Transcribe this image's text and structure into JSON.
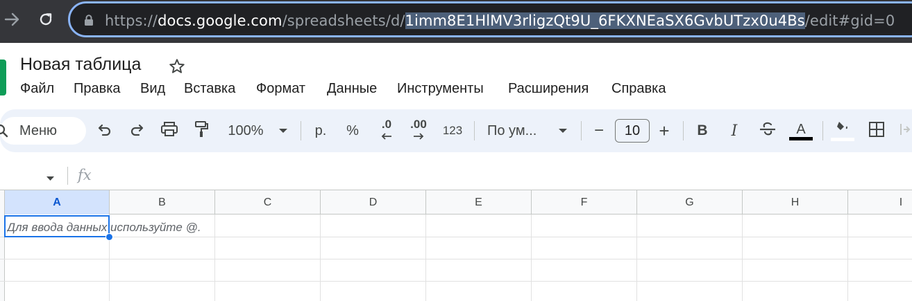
{
  "browser": {
    "url_prefix": "https://",
    "url_domain": "docs.google.com",
    "url_path": "/spreadsheets/d/",
    "url_selected": "1imm8E1HlMV3rligzQt9U_6FKXNEaSX6GvbUTzx0u4Bs",
    "url_suffix": "/edit#gid=0"
  },
  "doc": {
    "title": "Новая таблица"
  },
  "menu": {
    "items": [
      "Файл",
      "Правка",
      "Вид",
      "Вставка",
      "Формат",
      "Данные",
      "Инструменты",
      "Расширения",
      "Справка"
    ]
  },
  "toolbar": {
    "search_label": "Меню",
    "zoom": "100%",
    "currency": "р.",
    "percent": "%",
    "decrease_decimals": ".0",
    "increase_decimals": ".00",
    "number_format": "123",
    "font": "По ум...",
    "font_size": "10",
    "minus": "−",
    "plus": "+",
    "bold": "B",
    "italic": "I",
    "text_color_letter": "A",
    "text_color": "#000000",
    "fill_color": "#ffffff"
  },
  "formula_bar": {
    "fx": "fx"
  },
  "grid": {
    "columns": [
      "A",
      "B",
      "C",
      "D",
      "E",
      "F",
      "G",
      "H",
      "I"
    ],
    "active_column": "A",
    "a1_hint": "Для ввода данных используйте @."
  },
  "colors": {
    "selection": "#1a73e8",
    "toolbar_bg": "#edf2fa",
    "browser_bg": "#35363a",
    "url_focus": "#8ab4f8",
    "sheets_green": "#0f9d58"
  }
}
